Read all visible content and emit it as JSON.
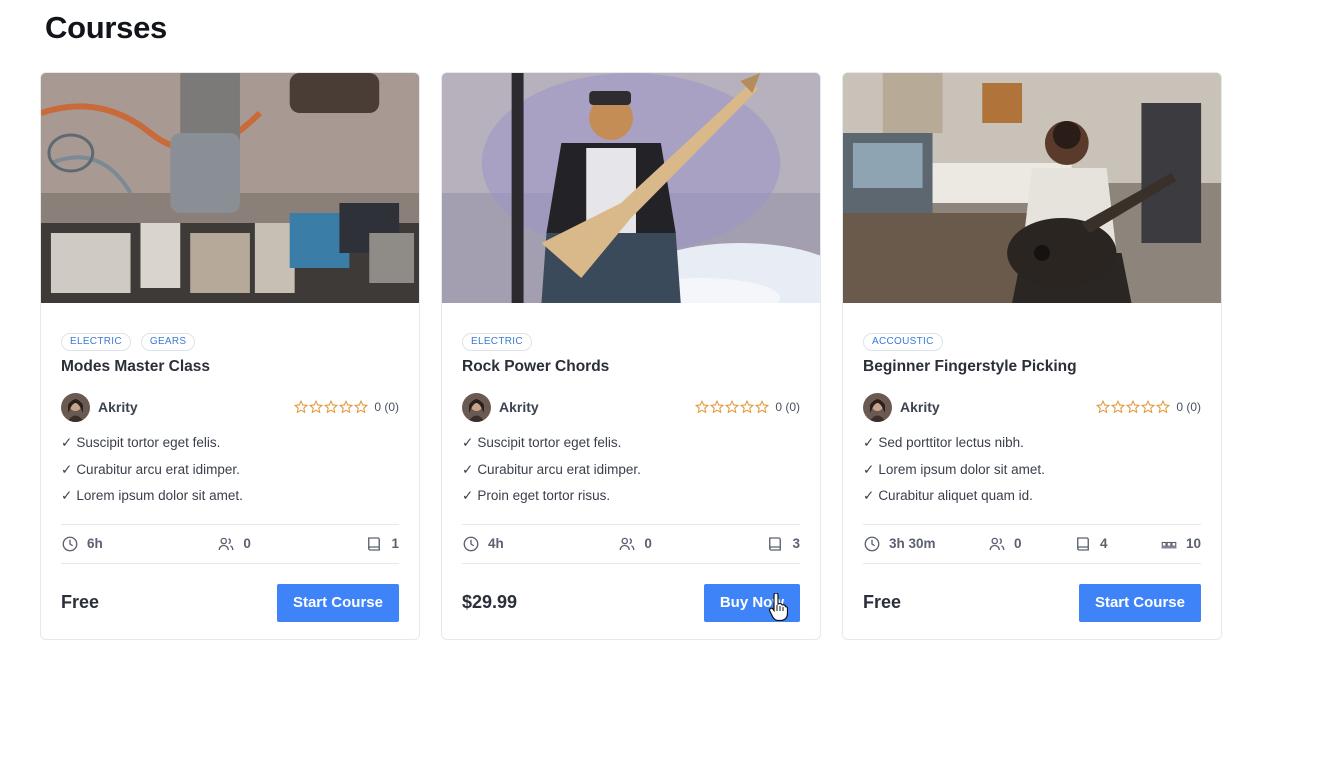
{
  "page": {
    "title": "Courses"
  },
  "colors": {
    "accent": "#3f83f8",
    "star": "#e2973b",
    "tag_text": "#3a7bd5"
  },
  "courses": [
    {
      "tags": [
        "ELECTRIC",
        "GEARS"
      ],
      "title": "Modes Master Class",
      "author": "Akrity",
      "rating": "0 (0)",
      "features": [
        "Suscipit tortor eget felis.",
        "Curabitur arcu erat idimper.",
        "Lorem ipsum dolor sit amet."
      ],
      "duration": "6h",
      "students": "0",
      "lessons": "1",
      "price": "Free",
      "button": "Start Course"
    },
    {
      "tags": [
        "ELECTRIC"
      ],
      "title": "Rock Power Chords",
      "author": "Akrity",
      "rating": "0 (0)",
      "features": [
        "Suscipit tortor eget felis.",
        "Curabitur arcu erat idimper.",
        "Proin eget tortor risus."
      ],
      "duration": "4h",
      "students": "0",
      "lessons": "3",
      "price": "$29.99",
      "button": "Buy Now"
    },
    {
      "tags": [
        "ACCOUSTIC"
      ],
      "title": "Beginner Fingerstyle Picking",
      "author": "Akrity",
      "rating": "0 (0)",
      "features": [
        "Sed porttitor lectus nibh.",
        "Lorem ipsum dolor sit amet.",
        "Curabitur aliquet quam id."
      ],
      "duration": "3h 30m",
      "students": "0",
      "lessons": "4",
      "seats": "10",
      "price": "Free",
      "button": "Start Course"
    }
  ]
}
